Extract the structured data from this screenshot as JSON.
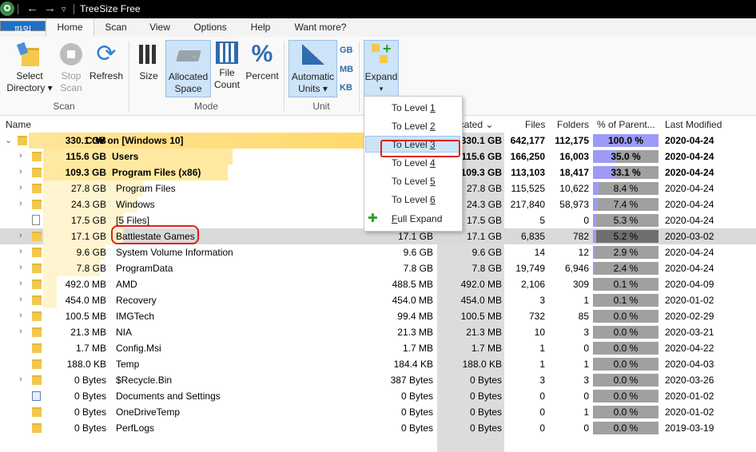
{
  "window": {
    "title": "TreeSize Free"
  },
  "ribbon_tabs": [
    "파일",
    "Home",
    "Scan",
    "View",
    "Options",
    "Help",
    "Want more?"
  ],
  "ribbon": {
    "scan": {
      "select_directory": [
        "Select",
        "Directory ▾"
      ],
      "stop_scan": [
        "Stop",
        "Scan"
      ],
      "refresh": "Refresh",
      "group_label": "Scan"
    },
    "mode": {
      "size": "Size",
      "allocated_space": [
        "Allocated",
        "Space"
      ],
      "file_count": [
        "File",
        "Count"
      ],
      "percent": "Percent",
      "group_label": "Mode"
    },
    "unit": {
      "automatic_units": [
        "Automatic",
        "Units ▾"
      ],
      "gb": "GB",
      "mb": "MB",
      "kb": "KB",
      "group_label": "Unit"
    },
    "expand": {
      "label": "Expand",
      "arrow": "▾"
    }
  },
  "columns": {
    "name": "Name",
    "allocated": "ocated ⌄",
    "files": "Files",
    "folders": "Folders",
    "percent": "% of Parent...",
    "modified": "Last Modified"
  },
  "accent_colors": {
    "file_tab": "#1f6fc5",
    "percent_bar": "#9c9bf7",
    "folder": "#f2c94c",
    "root_highlight": "#ffe78a",
    "annotation": "#e0201a"
  },
  "dropdown": {
    "items": [
      {
        "text": "To Level ",
        "key": "1"
      },
      {
        "text": "To Level ",
        "key": "2"
      },
      {
        "text": "To Level ",
        "key": "3"
      },
      {
        "text": "To Level ",
        "key": "4"
      },
      {
        "text": "To Level ",
        "key": "5"
      },
      {
        "text": "To Level ",
        "key": "6"
      }
    ],
    "full_expand": {
      "key": "F",
      "text": "ull Expand"
    }
  },
  "rows": [
    {
      "size": "330.1 GB",
      "name": "C:₩  on  [Windows 10]",
      "size2": "",
      "alloc": "330.1 GB",
      "files": "642,177",
      "folders": "112,175",
      "pct": "100.0 %",
      "pct_value": 100.0,
      "date": "2020-04-24",
      "bold": true,
      "icon": "folder"
    },
    {
      "size": "115.6 GB",
      "name": "Users",
      "size2": "",
      "alloc": "115.6 GB",
      "files": "166,250",
      "folders": "16,003",
      "pct": "35.0 %",
      "pct_value": 35.0,
      "date": "2020-04-24",
      "bold": true,
      "icon": "folder"
    },
    {
      "size": "109.3 GB",
      "name": "Program Files (x86)",
      "size2": "",
      "alloc": "109.3 GB",
      "files": "113,103",
      "folders": "18,417",
      "pct": "33.1 %",
      "pct_value": 33.1,
      "date": "2020-04-24",
      "bold": true,
      "icon": "folder"
    },
    {
      "size": "27.8 GB",
      "name": "Program Files",
      "size2": "",
      "alloc": "27.8 GB",
      "files": "115,525",
      "folders": "10,622",
      "pct": "8.4 %",
      "pct_value": 8.4,
      "date": "2020-04-24",
      "bold": false,
      "icon": "folder"
    },
    {
      "size": "24.3 GB",
      "name": "Windows",
      "size2": "",
      "alloc": "24.3 GB",
      "files": "217,840",
      "folders": "58,973",
      "pct": "7.4 %",
      "pct_value": 7.4,
      "date": "2020-04-24",
      "bold": false,
      "icon": "folder"
    },
    {
      "size": "17.5 GB",
      "name": "[5 Files]",
      "size2": "",
      "alloc": "17.5 GB",
      "files": "5",
      "folders": "0",
      "pct": "5.3 %",
      "pct_value": 5.3,
      "date": "2020-04-24",
      "bold": false,
      "icon": "file"
    },
    {
      "size": "17.1 GB",
      "name": "Battlestate Games",
      "size2": "17.1 GB",
      "alloc": "17.1 GB",
      "files": "6,835",
      "folders": "782",
      "pct": "5.2 %",
      "pct_value": 5.2,
      "date": "2020-03-02",
      "bold": false,
      "icon": "folder"
    },
    {
      "size": "9.6 GB",
      "name": "System Volume Information",
      "size2": "9.6 GB",
      "alloc": "9.6 GB",
      "files": "14",
      "folders": "12",
      "pct": "2.9 %",
      "pct_value": 2.9,
      "date": "2020-04-24",
      "bold": false,
      "icon": "folder"
    },
    {
      "size": "7.8 GB",
      "name": "ProgramData",
      "size2": "7.8 GB",
      "alloc": "7.8 GB",
      "files": "19,749",
      "folders": "6,946",
      "pct": "2.4 %",
      "pct_value": 2.4,
      "date": "2020-04-24",
      "bold": false,
      "icon": "folder"
    },
    {
      "size": "492.0 MB",
      "name": "AMD",
      "size2": "488.5 MB",
      "alloc": "492.0 MB",
      "files": "2,106",
      "folders": "309",
      "pct": "0.1 %",
      "pct_value": 0.1,
      "date": "2020-04-09",
      "bold": false,
      "icon": "folder"
    },
    {
      "size": "454.0 MB",
      "name": "Recovery",
      "size2": "454.0 MB",
      "alloc": "454.0 MB",
      "files": "3",
      "folders": "1",
      "pct": "0.1 %",
      "pct_value": 0.1,
      "date": "2020-01-02",
      "bold": false,
      "icon": "folder"
    },
    {
      "size": "100.5 MB",
      "name": "IMGTech",
      "size2": "99.4 MB",
      "alloc": "100.5 MB",
      "files": "732",
      "folders": "85",
      "pct": "0.0 %",
      "pct_value": 0.0,
      "date": "2020-02-29",
      "bold": false,
      "icon": "folder"
    },
    {
      "size": "21.3 MB",
      "name": "NIA",
      "size2": "21.3 MB",
      "alloc": "21.3 MB",
      "files": "10",
      "folders": "3",
      "pct": "0.0 %",
      "pct_value": 0.0,
      "date": "2020-03-21",
      "bold": false,
      "icon": "folder"
    },
    {
      "size": "1.7 MB",
      "name": "Config.Msi",
      "size2": "1.7 MB",
      "alloc": "1.7 MB",
      "files": "1",
      "folders": "0",
      "pct": "0.0 %",
      "pct_value": 0.0,
      "date": "2020-04-22",
      "bold": false,
      "icon": "folder"
    },
    {
      "size": "188.0 KB",
      "name": "Temp",
      "size2": "184.4 KB",
      "alloc": "188.0 KB",
      "files": "1",
      "folders": "1",
      "pct": "0.0 %",
      "pct_value": 0.0,
      "date": "2020-04-03",
      "bold": false,
      "icon": "folder"
    },
    {
      "size": "0 Bytes",
      "name": "$Recycle.Bin",
      "size2": "387 Bytes",
      "alloc": "0 Bytes",
      "files": "3",
      "folders": "3",
      "pct": "0.0 %",
      "pct_value": 0.0,
      "date": "2020-03-26",
      "bold": false,
      "icon": "folder"
    },
    {
      "size": "0 Bytes",
      "name": "Documents and Settings",
      "size2": "0 Bytes",
      "alloc": "0 Bytes",
      "files": "0",
      "folders": "0",
      "pct": "0.0 %",
      "pct_value": 0.0,
      "date": "2020-01-02",
      "bold": false,
      "icon": "shortcut"
    },
    {
      "size": "0 Bytes",
      "name": "OneDriveTemp",
      "size2": "0 Bytes",
      "alloc": "0 Bytes",
      "files": "0",
      "folders": "1",
      "pct": "0.0 %",
      "pct_value": 0.0,
      "date": "2020-01-02",
      "bold": false,
      "icon": "folder"
    },
    {
      "size": "0 Bytes",
      "name": "PerfLogs",
      "size2": "0 Bytes",
      "alloc": "0 Bytes",
      "files": "0",
      "folders": "0",
      "pct": "0.0 %",
      "pct_value": 0.0,
      "date": "2019-03-19",
      "bold": false,
      "icon": "folder"
    }
  ]
}
